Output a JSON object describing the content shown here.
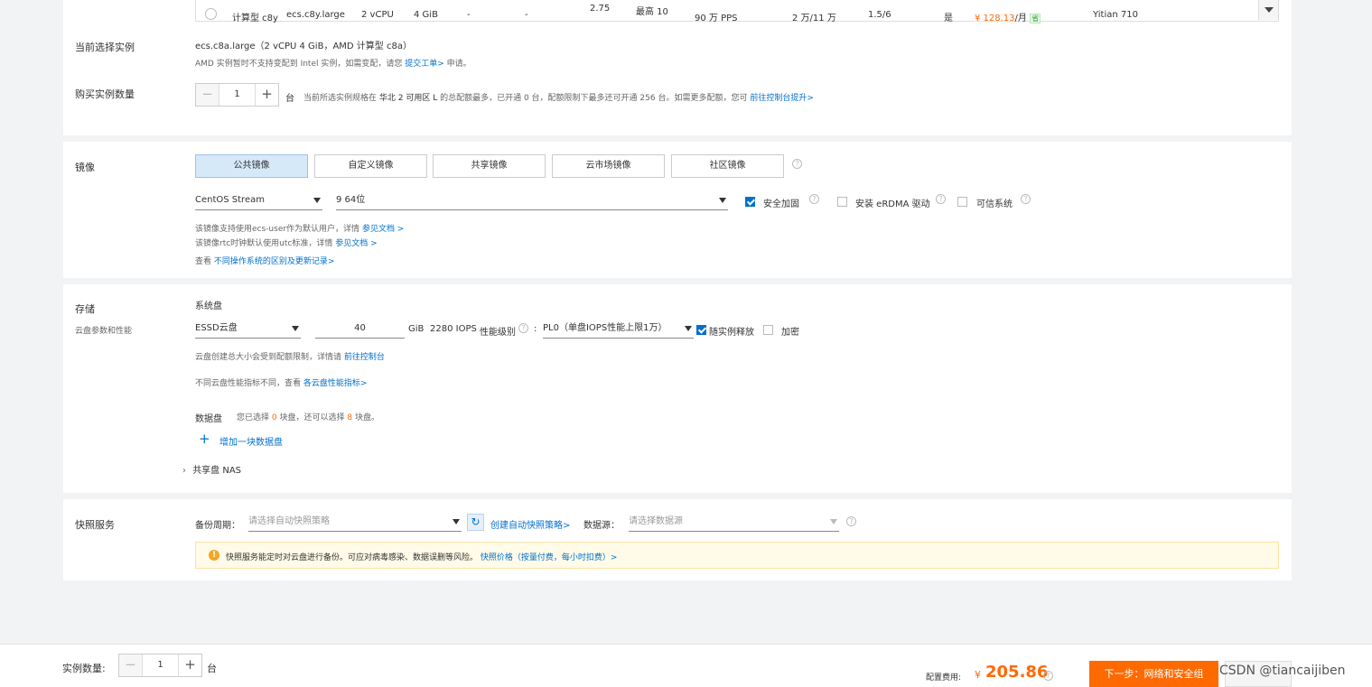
{
  "instance_row": {
    "family": "计算型 c8y",
    "type": "ecs.c8y.large",
    "vcpu": "2 vCPU",
    "mem": "4 GiB",
    "dash1": "-",
    "dash2": "-",
    "freq": "2.75",
    "burst": "最高 10",
    "pps": "90 万 PPS",
    "iops": "2 万/11 万",
    "ratio": "1.5/6",
    "yes": "是",
    "price": "¥ 128.13",
    "per": "/月",
    "save": "省",
    "cpu": "Yitian 710"
  },
  "current": {
    "label": "当前选择实例",
    "value": "ecs.c8a.large（2 vCPU 4 GiB，AMD 计算型 c8a）",
    "note_pre": "AMD 实例暂时不支持变配到 Intel 实例，如需变配，请您",
    "note_link": "提交工单>",
    "note_post": "申请。"
  },
  "quantity": {
    "label": "购买实例数量",
    "value": "1",
    "unit": "台",
    "note_pre": "当前所选实例规格在",
    "note_zone": "华北 2 可用区 L",
    "note_mid": "的总配额最多，已开通 0 台，配额限制下最多还可开通 256 台。如需更多配额，您可",
    "note_link": "前往控制台提升>"
  },
  "image": {
    "label": "镜像",
    "tabs": [
      "公共镜像",
      "自定义镜像",
      "共享镜像",
      "云市场镜像",
      "社区镜像"
    ],
    "os": "CentOS Stream",
    "version": "9 64位",
    "security_label": "安全加固",
    "erdma_label": "安装 eRDMA 驱动",
    "trusted_label": "可信系统",
    "note1_pre": "该镜像支持使用ecs-user作为默认用户，详情",
    "note1_link": "参见文档 >",
    "note2_pre": "该镜像rtc时钟默认使用utc标准，详情",
    "note2_link": "参见文档 >",
    "note3_pre": "查看",
    "note3_link": "不同操作系统的区别及更新记录>"
  },
  "storage": {
    "label": "存储",
    "sublabel": "云盘参数和性能",
    "system_disk": "系统盘",
    "disk_type": "ESSD云盘",
    "size": "40",
    "unit": "GiB",
    "iops": "2280 IOPS",
    "perf_label": "性能级别",
    "perf_value": "PL0（单盘IOPS性能上限1万）",
    "release_label": "随实例释放",
    "encrypt_label": "加密",
    "note1_pre": "云盘创建总大小会受到配额限制，详情请",
    "note1_link": "前往控制台",
    "note2_pre": "不同云盘性能指标不同，查看",
    "note2_link": "各云盘性能指标>",
    "data_disk": "数据盘",
    "data_note_pre": "您已选择",
    "data_note_n1": "0",
    "data_note_mid": "块盘，还可以选择",
    "data_note_n2": "8",
    "data_note_post": "块盘。",
    "add_disk": "增加一块数据盘",
    "nas": "共享盘 NAS"
  },
  "snapshot": {
    "label": "快照服务",
    "period_label": "备份周期：",
    "period_placeholder": "请选择自动快照策略",
    "create_link": "创建自动快照策略>",
    "source_label": "数据源：",
    "source_placeholder": "请选择数据源",
    "tip_pre": "快照服务能定时对云盘进行备份。可应对病毒感染、数据误删等风险。",
    "tip_link": "快照价格（按量付费，每小时扣费）>"
  },
  "footer": {
    "qty_label": "实例数量:",
    "qty_value": "1",
    "qty_unit": "台",
    "fee_label": "配置费用:",
    "fee_currency": "¥",
    "fee_value": "205.86",
    "next_button": "下一步：网络和安全组",
    "watermark": "CSDN @tiancaijiben"
  },
  "colors": {
    "accent": "#0070cc",
    "primary_button": "#ff6a00",
    "price": "#ff6a00"
  }
}
